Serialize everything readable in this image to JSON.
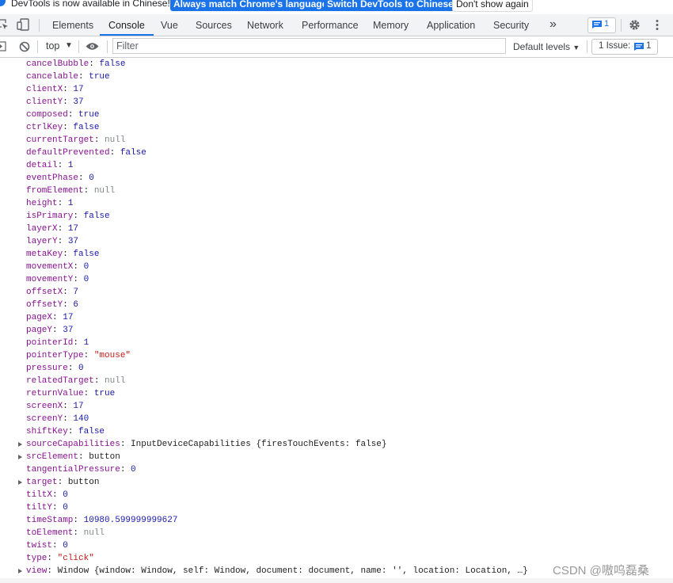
{
  "banner": {
    "message": "DevTools is now available in Chinese!",
    "btn_match": "Always match Chrome's language",
    "btn_switch": "Switch DevTools to Chinese",
    "btn_dismiss": "Don't show again"
  },
  "tabs": [
    {
      "label": "Elements"
    },
    {
      "label": "Console",
      "active": true
    },
    {
      "label": "Vue"
    },
    {
      "label": "Sources"
    },
    {
      "label": "Network"
    },
    {
      "label": "Performance"
    },
    {
      "label": "Memory"
    },
    {
      "label": "Application"
    },
    {
      "label": "Security"
    }
  ],
  "tabbar": {
    "more_label": "»",
    "messages_count": "1"
  },
  "toolbar": {
    "context": "top",
    "filter_placeholder": "Filter",
    "levels": "Default levels",
    "issues_label": "1 Issue:",
    "issues_count": "1"
  },
  "properties": [
    {
      "key": "cancelBubble",
      "value": "false",
      "type": "bool"
    },
    {
      "key": "cancelable",
      "value": "true",
      "type": "bool"
    },
    {
      "key": "clientX",
      "value": "17",
      "type": "num"
    },
    {
      "key": "clientY",
      "value": "37",
      "type": "num"
    },
    {
      "key": "composed",
      "value": "true",
      "type": "bool"
    },
    {
      "key": "ctrlKey",
      "value": "false",
      "type": "bool"
    },
    {
      "key": "currentTarget",
      "value": "null",
      "type": "null"
    },
    {
      "key": "defaultPrevented",
      "value": "false",
      "type": "bool"
    },
    {
      "key": "detail",
      "value": "1",
      "type": "num"
    },
    {
      "key": "eventPhase",
      "value": "0",
      "type": "num"
    },
    {
      "key": "fromElement",
      "value": "null",
      "type": "null"
    },
    {
      "key": "height",
      "value": "1",
      "type": "num"
    },
    {
      "key": "isPrimary",
      "value": "false",
      "type": "bool"
    },
    {
      "key": "layerX",
      "value": "17",
      "type": "num"
    },
    {
      "key": "layerY",
      "value": "37",
      "type": "num"
    },
    {
      "key": "metaKey",
      "value": "false",
      "type": "bool"
    },
    {
      "key": "movementX",
      "value": "0",
      "type": "num"
    },
    {
      "key": "movementY",
      "value": "0",
      "type": "num"
    },
    {
      "key": "offsetX",
      "value": "7",
      "type": "num"
    },
    {
      "key": "offsetY",
      "value": "6",
      "type": "num"
    },
    {
      "key": "pageX",
      "value": "17",
      "type": "num"
    },
    {
      "key": "pageY",
      "value": "37",
      "type": "num"
    },
    {
      "key": "pointerId",
      "value": "1",
      "type": "num"
    },
    {
      "key": "pointerType",
      "value": "\"mouse\"",
      "type": "str"
    },
    {
      "key": "pressure",
      "value": "0",
      "type": "num"
    },
    {
      "key": "relatedTarget",
      "value": "null",
      "type": "null"
    },
    {
      "key": "returnValue",
      "value": "true",
      "type": "bool"
    },
    {
      "key": "screenX",
      "value": "17",
      "type": "num"
    },
    {
      "key": "screenY",
      "value": "140",
      "type": "num"
    },
    {
      "key": "shiftKey",
      "value": "false",
      "type": "bool"
    },
    {
      "key": "sourceCapabilities",
      "value": "InputDeviceCapabilities {firesTouchEvents: false}",
      "type": "obj",
      "expandable": true
    },
    {
      "key": "srcElement",
      "value": "button",
      "type": "obj",
      "expandable": true
    },
    {
      "key": "tangentialPressure",
      "value": "0",
      "type": "num"
    },
    {
      "key": "target",
      "value": "button",
      "type": "obj",
      "expandable": true
    },
    {
      "key": "tiltX",
      "value": "0",
      "type": "num"
    },
    {
      "key": "tiltY",
      "value": "0",
      "type": "num"
    },
    {
      "key": "timeStamp",
      "value": "10980.599999999627",
      "type": "num"
    },
    {
      "key": "toElement",
      "value": "null",
      "type": "null"
    },
    {
      "key": "twist",
      "value": "0",
      "type": "num"
    },
    {
      "key": "type",
      "value": "\"click\"",
      "type": "str"
    },
    {
      "key": "view",
      "value": "Window {window: Window, self: Window, document: document, name: '', location: Location, …}",
      "type": "obj",
      "expandable": true
    }
  ],
  "watermark": "CSDN @嗷呜磊桑",
  "colors": {
    "accent": "#1a73e8",
    "key": "#881391",
    "value": "#1a1aa6",
    "string": "#c41a16",
    "null": "#80868b"
  }
}
